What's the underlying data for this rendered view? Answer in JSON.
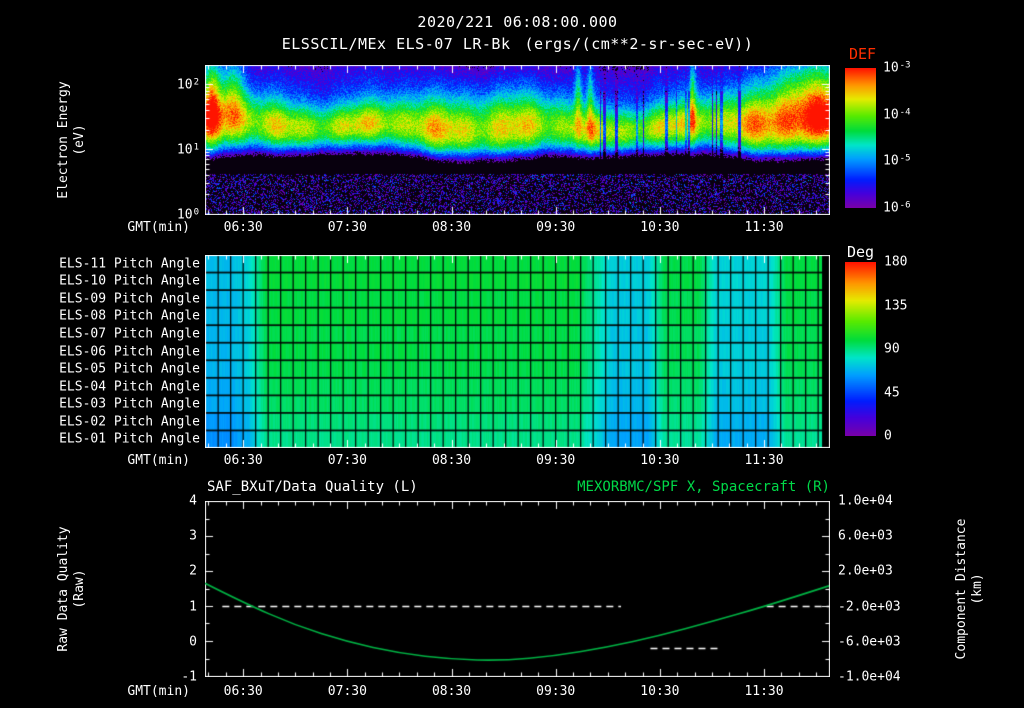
{
  "header": {
    "datetime": "2020/221 06:08:00.000",
    "instrument_title": "ELSSCIL/MEx ELS-07 LR-Bk",
    "units_title": "(ergs/(cm**2-sr-sec-eV))"
  },
  "colors": {
    "background": "#000000",
    "text": "#ffffff",
    "def_title": "#ff2e00",
    "green_title": "#00d848",
    "spacecraft_curve": "#00b344",
    "quality_dashes": "#ffffff"
  },
  "time_axis": {
    "label": "GMT(min)",
    "start_time": "06:08:00",
    "span_minutes": 360,
    "major_ticks": [
      {
        "label": "06:30",
        "minute": 22
      },
      {
        "label": "07:30",
        "minute": 82
      },
      {
        "label": "08:30",
        "minute": 142
      },
      {
        "label": "09:30",
        "minute": 202
      },
      {
        "label": "10:30",
        "minute": 262
      },
      {
        "label": "11:30",
        "minute": 322
      }
    ],
    "minor_tick_every_minutes": 10
  },
  "chart_data": [
    {
      "id": "electron_spectrogram",
      "type": "heatmap",
      "title": "ELSSCIL/MEx ELS-07 LR-Bk",
      "units": "ergs/(cm**2-sr-sec-eV)",
      "ylabel_lines": {
        "l1": "Electron Energy",
        "l2": "(eV)"
      },
      "xlabel": "GMT(min)",
      "y_scale": "log",
      "y_range_ev": [
        1,
        200
      ],
      "y_ticks": [
        {
          "label": "10^2",
          "log10": 2
        },
        {
          "label": "10^1",
          "log10": 1
        },
        {
          "label": "10^0",
          "log10": 0
        }
      ],
      "colorbar": {
        "label": "DEF",
        "scale": "log",
        "top_value": 0.001,
        "bottom_value": 1e-06,
        "ticks": [
          "10^-3",
          "10^-4",
          "10^-5",
          "10^-6"
        ]
      },
      "features": {
        "core_band": {
          "center_ev": 21,
          "sigma_decades": 0.3,
          "peak_flux_ergs": 8e-05
        },
        "background_flux_ergs": 6e-07,
        "low_energy_dark_gap_ev": [
          4,
          8
        ],
        "high_energy_bursts": [
          {
            "minute": 4,
            "amp": 1.2,
            "sigma_min": 3.6
          },
          {
            "minute": 16,
            "amp": 1.0,
            "sigma_min": 4.5
          },
          {
            "minute": 215,
            "amp": 0.9,
            "sigma_min": 1.6
          },
          {
            "minute": 222,
            "amp": 0.75,
            "sigma_min": 1.4
          },
          {
            "minute": 281,
            "amp": 0.85,
            "sigma_min": 1.4
          },
          {
            "minute": 349,
            "amp": 1.3,
            "sigma_min": 18
          }
        ],
        "dropout_streaks_minutes": [
          227,
          317
        ],
        "right_edge_bright_band": true
      }
    },
    {
      "id": "pitch_angle_grid",
      "type": "heatmap",
      "rows": [
        "ELS-11 Pitch Angle",
        "ELS-10 Pitch Angle",
        "ELS-09 Pitch Angle",
        "ELS-08 Pitch Angle",
        "ELS-07 Pitch Angle",
        "ELS-06 Pitch Angle",
        "ELS-05 Pitch Angle",
        "ELS-04 Pitch Angle",
        "ELS-03 Pitch Angle",
        "ELS-02 Pitch Angle",
        "ELS-01 Pitch Angle"
      ],
      "units": "deg",
      "column_minutes": 10,
      "columns": 36,
      "right_data_gap_minutes": 4,
      "colorbar": {
        "label": "Deg",
        "top_value": 180,
        "bottom_value": 0,
        "ticks": [
          "180",
          "135",
          "90",
          "45",
          "0"
        ]
      },
      "values_deg": [
        [
          70,
          70,
          77,
          99,
          99,
          99,
          99,
          99,
          99,
          99,
          99,
          99,
          99,
          99,
          99,
          99,
          99,
          99,
          99,
          99,
          99,
          99,
          87,
          74,
          74,
          74,
          97,
          97,
          97,
          76,
          76,
          76,
          76,
          98,
          98,
          98
        ],
        [
          71,
          71,
          78,
          100,
          100,
          100,
          100,
          100,
          100,
          100,
          100,
          100,
          100,
          100,
          100,
          100,
          100,
          100,
          100,
          100,
          100,
          100,
          88,
          75,
          75,
          75,
          98,
          98,
          98,
          77,
          77,
          77,
          77,
          99,
          99,
          99
        ],
        [
          69,
          69,
          76,
          98,
          98,
          98,
          98,
          98,
          98,
          98,
          98,
          98,
          98,
          98,
          98,
          98,
          98,
          98,
          98,
          98,
          98,
          98,
          86,
          73,
          73,
          73,
          96,
          96,
          96,
          75,
          75,
          75,
          75,
          97,
          97,
          97
        ],
        [
          70,
          70,
          77,
          99,
          99,
          99,
          99,
          99,
          99,
          99,
          99,
          99,
          99,
          99,
          99,
          99,
          99,
          99,
          99,
          99,
          99,
          99,
          87,
          74,
          74,
          74,
          97,
          97,
          97,
          76,
          76,
          76,
          76,
          98,
          98,
          98
        ],
        [
          68,
          68,
          75,
          97,
          97,
          97,
          97,
          97,
          97,
          97,
          97,
          97,
          97,
          97,
          97,
          97,
          97,
          97,
          97,
          97,
          97,
          97,
          85,
          72,
          72,
          72,
          95,
          95,
          95,
          74,
          74,
          74,
          74,
          96,
          96,
          96
        ],
        [
          69,
          69,
          76,
          98,
          98,
          98,
          98,
          98,
          98,
          98,
          98,
          98,
          98,
          98,
          98,
          98,
          98,
          98,
          98,
          98,
          98,
          98,
          86,
          73,
          73,
          73,
          96,
          96,
          96,
          75,
          75,
          75,
          75,
          97,
          97,
          97
        ],
        [
          68,
          68,
          75,
          97,
          97,
          97,
          97,
          97,
          97,
          97,
          97,
          97,
          97,
          97,
          97,
          97,
          97,
          97,
          97,
          97,
          97,
          97,
          85,
          72,
          72,
          72,
          95,
          95,
          95,
          74,
          74,
          74,
          74,
          96,
          96,
          96
        ],
        [
          66,
          66,
          73,
          95,
          95,
          95,
          95,
          95,
          95,
          95,
          95,
          95,
          95,
          95,
          95,
          95,
          95,
          95,
          95,
          95,
          95,
          95,
          83,
          70,
          70,
          70,
          93,
          93,
          93,
          72,
          72,
          72,
          72,
          94,
          94,
          94
        ],
        [
          65,
          65,
          72,
          94,
          94,
          94,
          94,
          94,
          94,
          94,
          94,
          94,
          94,
          94,
          94,
          94,
          94,
          94,
          94,
          94,
          94,
          94,
          82,
          69,
          69,
          69,
          92,
          92,
          92,
          71,
          71,
          71,
          71,
          93,
          93,
          93
        ],
        [
          62,
          62,
          69,
          91,
          91,
          91,
          91,
          91,
          91,
          91,
          91,
          91,
          91,
          91,
          91,
          91,
          91,
          91,
          91,
          91,
          91,
          91,
          79,
          66,
          66,
          66,
          89,
          89,
          89,
          68,
          68,
          68,
          68,
          90,
          90,
          90
        ],
        [
          60,
          60,
          67,
          89,
          89,
          89,
          89,
          89,
          89,
          89,
          89,
          89,
          89,
          89,
          89,
          89,
          89,
          89,
          89,
          89,
          89,
          89,
          77,
          64,
          64,
          64,
          87,
          87,
          87,
          66,
          66,
          66,
          66,
          88,
          88,
          88
        ]
      ]
    },
    {
      "id": "quality_and_spacecraft_x",
      "type": "line",
      "left_title": "SAF_BXuT/Data Quality (L)",
      "right_title": "MEXORBMC/SPF X, Spacecraft (R)",
      "xlabel": "GMT(min)",
      "ylabel_left_lines": {
        "l1": "Raw Data Quality",
        "l2": "(Raw)"
      },
      "ylabel_right_lines": {
        "l1": "Component Distance",
        "l2": "(km)"
      },
      "ylim_left": [
        -1,
        4
      ],
      "yticks_left": [
        {
          "label": "4",
          "value": 4
        },
        {
          "label": "3",
          "value": 3
        },
        {
          "label": "2",
          "value": 2
        },
        {
          "label": "1",
          "value": 1
        },
        {
          "label": "0",
          "value": 0
        },
        {
          "label": "-1",
          "value": -1
        }
      ],
      "ylim_right": [
        -10000,
        10000
      ],
      "yticks_right": [
        {
          "label": "1.0e+04",
          "value": 10000
        },
        {
          "label": "6.0e+03",
          "value": 6000
        },
        {
          "label": "2.0e+03",
          "value": 2000
        },
        {
          "label": "-2.0e+03",
          "value": -2000
        },
        {
          "label": "-6.0e+03",
          "value": -6000
        },
        {
          "label": "-1.0e+04",
          "value": -10000
        }
      ],
      "series": [
        {
          "name": "SAF_BXuT/Data Quality",
          "axis": "left",
          "style": "dashed",
          "color": "#ffffff",
          "segments": [
            {
              "value": 1,
              "start_minute": 10,
              "end_minute": 240
            },
            {
              "value": -0.2,
              "start_minute": 257,
              "end_minute": 297
            },
            {
              "value": 1,
              "start_minute": 324,
              "end_minute": 360
            }
          ]
        },
        {
          "name": "MEXORBMC/SPF X, Spacecraft",
          "axis": "right",
          "style": "solid",
          "color": "#00b344",
          "points": [
            {
              "minute": 0,
              "km": 600
            },
            {
              "minute": 22,
              "km": -1600
            },
            {
              "minute": 52,
              "km": -4200
            },
            {
              "minute": 82,
              "km": -6100
            },
            {
              "minute": 112,
              "km": -7400
            },
            {
              "minute": 142,
              "km": -8100
            },
            {
              "minute": 172,
              "km": -8250
            },
            {
              "minute": 202,
              "km": -7700
            },
            {
              "minute": 232,
              "km": -6700
            },
            {
              "minute": 262,
              "km": -5400
            },
            {
              "minute": 292,
              "km": -3800
            },
            {
              "minute": 322,
              "km": -2100
            },
            {
              "minute": 360,
              "km": 300
            }
          ]
        }
      ]
    }
  ]
}
